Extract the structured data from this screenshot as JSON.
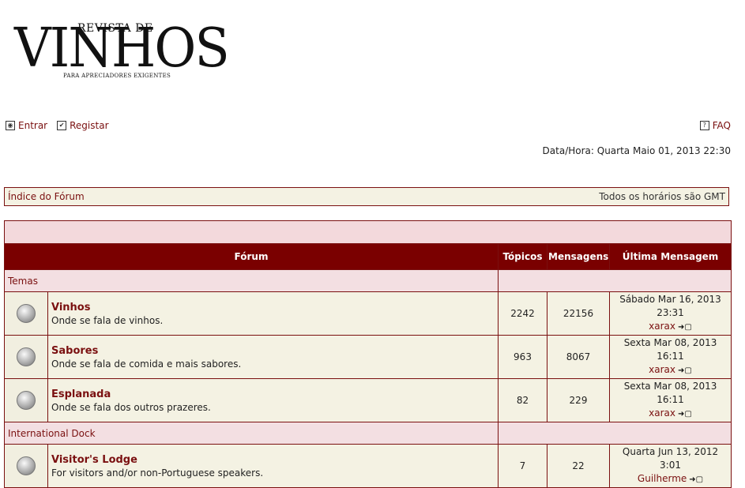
{
  "logo": {
    "top": "REVISTA DE",
    "main": "VINHOS",
    "tagline": "PARA APRECIADORES EXIGENTES"
  },
  "toplinks": {
    "login": "Entrar",
    "register": "Registar",
    "faq": "FAQ"
  },
  "datetime": "Data/Hora: Quarta Maio 01, 2013 22:30",
  "nav": {
    "index": "Índice do Fórum",
    "timezone": "Todos os horários são GMT"
  },
  "table": {
    "headers": {
      "forum": "Fórum",
      "topics": "Tópicos",
      "posts": "Mensagens",
      "last": "Última Mensagem"
    },
    "categories": [
      {
        "name": "Temas",
        "forums": [
          {
            "title": "Vinhos",
            "desc": "Onde se fala de vinhos.",
            "topics": "2242",
            "posts": "22156",
            "last_date": "Sábado Mar 16, 2013 23:31",
            "last_user": "xarax"
          },
          {
            "title": "Sabores",
            "desc": "Onde se fala de comida e mais sabores.",
            "topics": "963",
            "posts": "8067",
            "last_date": "Sexta Mar 08, 2013 16:11",
            "last_user": "xarax"
          },
          {
            "title": "Esplanada",
            "desc": "Onde se fala dos outros prazeres.",
            "topics": "82",
            "posts": "229",
            "last_date": "Sexta Mar 08, 2013 16:11",
            "last_user": "xarax"
          }
        ]
      },
      {
        "name": "International Dock",
        "forums": [
          {
            "title": "Visitor's Lodge",
            "desc": "For visitors and/or non-Portuguese speakers.",
            "topics": "7",
            "posts": "22",
            "last_date": "Quarta Jun 13, 2012 3:01",
            "last_user": "Guilherme"
          }
        ]
      }
    ]
  },
  "colors": {
    "accent": "#7a0000",
    "border": "#7a1010",
    "row_bg": "#f4f2e3",
    "category_bg": "#f3dfe2"
  }
}
